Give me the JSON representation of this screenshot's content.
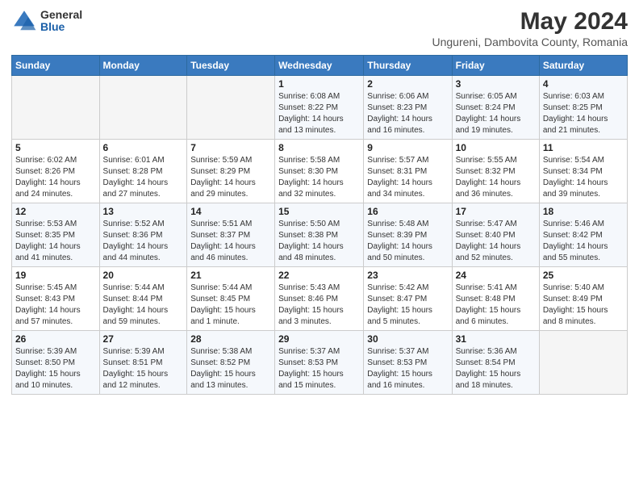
{
  "header": {
    "title": "May 2024",
    "subtitle": "Ungureni, Dambovita County, Romania",
    "logo_general": "General",
    "logo_blue": "Blue"
  },
  "weekdays": [
    "Sunday",
    "Monday",
    "Tuesday",
    "Wednesday",
    "Thursday",
    "Friday",
    "Saturday"
  ],
  "weeks": [
    [
      {
        "day": "",
        "info": ""
      },
      {
        "day": "",
        "info": ""
      },
      {
        "day": "",
        "info": ""
      },
      {
        "day": "1",
        "info": "Sunrise: 6:08 AM\nSunset: 8:22 PM\nDaylight: 14 hours\nand 13 minutes."
      },
      {
        "day": "2",
        "info": "Sunrise: 6:06 AM\nSunset: 8:23 PM\nDaylight: 14 hours\nand 16 minutes."
      },
      {
        "day": "3",
        "info": "Sunrise: 6:05 AM\nSunset: 8:24 PM\nDaylight: 14 hours\nand 19 minutes."
      },
      {
        "day": "4",
        "info": "Sunrise: 6:03 AM\nSunset: 8:25 PM\nDaylight: 14 hours\nand 21 minutes."
      }
    ],
    [
      {
        "day": "5",
        "info": "Sunrise: 6:02 AM\nSunset: 8:26 PM\nDaylight: 14 hours\nand 24 minutes."
      },
      {
        "day": "6",
        "info": "Sunrise: 6:01 AM\nSunset: 8:28 PM\nDaylight: 14 hours\nand 27 minutes."
      },
      {
        "day": "7",
        "info": "Sunrise: 5:59 AM\nSunset: 8:29 PM\nDaylight: 14 hours\nand 29 minutes."
      },
      {
        "day": "8",
        "info": "Sunrise: 5:58 AM\nSunset: 8:30 PM\nDaylight: 14 hours\nand 32 minutes."
      },
      {
        "day": "9",
        "info": "Sunrise: 5:57 AM\nSunset: 8:31 PM\nDaylight: 14 hours\nand 34 minutes."
      },
      {
        "day": "10",
        "info": "Sunrise: 5:55 AM\nSunset: 8:32 PM\nDaylight: 14 hours\nand 36 minutes."
      },
      {
        "day": "11",
        "info": "Sunrise: 5:54 AM\nSunset: 8:34 PM\nDaylight: 14 hours\nand 39 minutes."
      }
    ],
    [
      {
        "day": "12",
        "info": "Sunrise: 5:53 AM\nSunset: 8:35 PM\nDaylight: 14 hours\nand 41 minutes."
      },
      {
        "day": "13",
        "info": "Sunrise: 5:52 AM\nSunset: 8:36 PM\nDaylight: 14 hours\nand 44 minutes."
      },
      {
        "day": "14",
        "info": "Sunrise: 5:51 AM\nSunset: 8:37 PM\nDaylight: 14 hours\nand 46 minutes."
      },
      {
        "day": "15",
        "info": "Sunrise: 5:50 AM\nSunset: 8:38 PM\nDaylight: 14 hours\nand 48 minutes."
      },
      {
        "day": "16",
        "info": "Sunrise: 5:48 AM\nSunset: 8:39 PM\nDaylight: 14 hours\nand 50 minutes."
      },
      {
        "day": "17",
        "info": "Sunrise: 5:47 AM\nSunset: 8:40 PM\nDaylight: 14 hours\nand 52 minutes."
      },
      {
        "day": "18",
        "info": "Sunrise: 5:46 AM\nSunset: 8:42 PM\nDaylight: 14 hours\nand 55 minutes."
      }
    ],
    [
      {
        "day": "19",
        "info": "Sunrise: 5:45 AM\nSunset: 8:43 PM\nDaylight: 14 hours\nand 57 minutes."
      },
      {
        "day": "20",
        "info": "Sunrise: 5:44 AM\nSunset: 8:44 PM\nDaylight: 14 hours\nand 59 minutes."
      },
      {
        "day": "21",
        "info": "Sunrise: 5:44 AM\nSunset: 8:45 PM\nDaylight: 15 hours\nand 1 minute."
      },
      {
        "day": "22",
        "info": "Sunrise: 5:43 AM\nSunset: 8:46 PM\nDaylight: 15 hours\nand 3 minutes."
      },
      {
        "day": "23",
        "info": "Sunrise: 5:42 AM\nSunset: 8:47 PM\nDaylight: 15 hours\nand 5 minutes."
      },
      {
        "day": "24",
        "info": "Sunrise: 5:41 AM\nSunset: 8:48 PM\nDaylight: 15 hours\nand 6 minutes."
      },
      {
        "day": "25",
        "info": "Sunrise: 5:40 AM\nSunset: 8:49 PM\nDaylight: 15 hours\nand 8 minutes."
      }
    ],
    [
      {
        "day": "26",
        "info": "Sunrise: 5:39 AM\nSunset: 8:50 PM\nDaylight: 15 hours\nand 10 minutes."
      },
      {
        "day": "27",
        "info": "Sunrise: 5:39 AM\nSunset: 8:51 PM\nDaylight: 15 hours\nand 12 minutes."
      },
      {
        "day": "28",
        "info": "Sunrise: 5:38 AM\nSunset: 8:52 PM\nDaylight: 15 hours\nand 13 minutes."
      },
      {
        "day": "29",
        "info": "Sunrise: 5:37 AM\nSunset: 8:53 PM\nDaylight: 15 hours\nand 15 minutes."
      },
      {
        "day": "30",
        "info": "Sunrise: 5:37 AM\nSunset: 8:53 PM\nDaylight: 15 hours\nand 16 minutes."
      },
      {
        "day": "31",
        "info": "Sunrise: 5:36 AM\nSunset: 8:54 PM\nDaylight: 15 hours\nand 18 minutes."
      },
      {
        "day": "",
        "info": ""
      }
    ]
  ]
}
